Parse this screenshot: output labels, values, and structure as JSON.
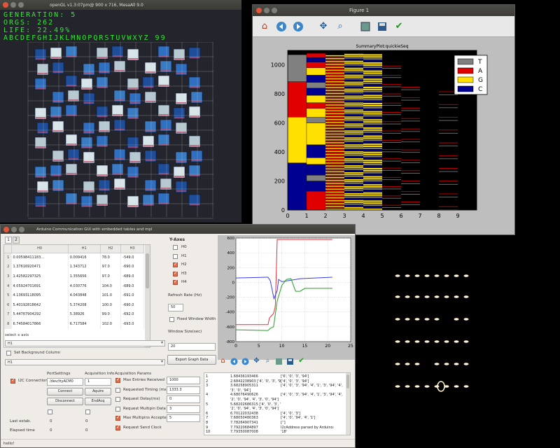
{
  "opengl": {
    "title": "openGL v1.3:07pm@ 900 x 716, MesaAll 9.0",
    "hud": [
      "GENERATION: 5",
      "ORGS: 262",
      "LIFE:   22.49%",
      "ABCDEFGHIJKLMNOPQRSTUVWXYZ 99"
    ]
  },
  "figure": {
    "title": "Figure 1",
    "toolbar": [
      "home-icon",
      "back-icon",
      "forward-icon",
      "pan-icon",
      "zoom-icon",
      "configure-icon",
      "save-icon",
      "check-icon"
    ]
  },
  "chart_data": [
    {
      "type": "bar",
      "title": "SummaryPlot:quickieSeq",
      "x": [
        0,
        1,
        2,
        3,
        4,
        5,
        6,
        7,
        8,
        9
      ],
      "xlim": [
        0,
        10
      ],
      "ylim": [
        0,
        1100
      ],
      "yticks": [
        0,
        200,
        400,
        600,
        800,
        1000
      ],
      "legend": {
        "position": "top-right",
        "entries": [
          {
            "label": "T",
            "color": "#808080"
          },
          {
            "label": "A",
            "color": "#e00000"
          },
          {
            "label": "G",
            "color": "#ffe000"
          },
          {
            "label": "C",
            "color": "#000090"
          }
        ]
      },
      "columns": [
        {
          "x": 0,
          "segments": [
            {
              "base": "C",
              "from": 0,
              "to": 325
            },
            {
              "base": "G",
              "from": 325,
              "to": 640
            },
            {
              "base": "A",
              "from": 640,
              "to": 885
            },
            {
              "base": "T",
              "from": 885,
              "to": 1070
            }
          ]
        },
        {
          "x": 1,
          "segments": [
            {
              "base": "A",
              "from": 0,
              "to": 130
            },
            {
              "base": "C",
              "from": 130,
              "to": 200
            },
            {
              "base": "T",
              "from": 200,
              "to": 240
            },
            {
              "base": "C",
              "from": 240,
              "to": 315
            },
            {
              "base": "G",
              "from": 315,
              "to": 360
            },
            {
              "base": "C",
              "from": 360,
              "to": 450
            },
            {
              "base": "G",
              "from": 450,
              "to": 600
            },
            {
              "base": "T",
              "from": 600,
              "to": 640
            },
            {
              "base": "G",
              "from": 640,
              "to": 700
            },
            {
              "base": "A",
              "from": 700,
              "to": 740
            },
            {
              "base": "G",
              "from": 740,
              "to": 790
            },
            {
              "base": "C",
              "from": 790,
              "to": 840
            },
            {
              "base": "T",
              "from": 840,
              "to": 880
            },
            {
              "base": "C",
              "from": 880,
              "to": 930
            },
            {
              "base": "G",
              "from": 930,
              "to": 980
            },
            {
              "base": "A",
              "from": 980,
              "to": 1020
            },
            {
              "base": "C",
              "from": 1020,
              "to": 1050
            },
            {
              "base": "A",
              "from": 1050,
              "to": 1080
            }
          ]
        }
      ],
      "max_length": 1070,
      "note_columns": "columns 2-8 show progressively thinner striped base composition with similar palette"
    },
    {
      "type": "line",
      "xlim": [
        0,
        25
      ],
      "ylim": [
        -800,
        600
      ],
      "xticks": [
        0,
        5,
        10,
        15,
        20,
        25
      ],
      "yticks": [
        -800,
        -600,
        -400,
        -200,
        0,
        200,
        400,
        600
      ],
      "series": [
        {
          "name": "H3",
          "color": "#e0303a",
          "points": [
            [
              0,
              -570
            ],
            [
              7,
              -570
            ],
            [
              7.3,
              -480
            ],
            [
              7.6,
              -460
            ],
            [
              8.2,
              -420
            ],
            [
              8.5,
              -350
            ],
            [
              8.6,
              -300
            ],
            [
              9,
              580
            ],
            [
              21,
              580
            ]
          ]
        },
        {
          "name": "H4",
          "color": "#3a3aef",
          "points": [
            [
              0,
              60
            ],
            [
              7,
              70
            ],
            [
              7.5,
              20
            ],
            [
              8.3,
              -220
            ],
            [
              9,
              -110
            ],
            [
              9.3,
              40
            ],
            [
              10,
              10
            ],
            [
              13,
              40
            ],
            [
              14,
              50
            ],
            [
              21,
              70
            ]
          ]
        },
        {
          "name": "H2",
          "color": "#22a022",
          "points": [
            [
              0,
              -640
            ],
            [
              7,
              -650
            ],
            [
              7.5,
              -620
            ],
            [
              8.2,
              -600
            ],
            [
              9,
              -250
            ],
            [
              10,
              -40
            ],
            [
              11,
              40
            ],
            [
              12,
              50
            ],
            [
              13,
              -120
            ],
            [
              14,
              -120
            ],
            [
              15,
              -80
            ],
            [
              21,
              -80
            ]
          ]
        }
      ]
    }
  ],
  "arduino": {
    "title": "Arduino Communication GUI with embedded tables and mpl",
    "tabs": [
      "1",
      "2"
    ],
    "table": {
      "headers": [
        "H0",
        "H1",
        "H2",
        "H3"
      ],
      "rows": [
        [
          "1",
          "0.00598411183...",
          "0.009416",
          "78.0",
          "-549.0"
        ],
        [
          "2",
          "1.37616920471",
          "1.343712",
          "97.0",
          "-690.0"
        ],
        [
          "3",
          "1.42582297325",
          "1.355656",
          "97.0",
          "-689.0"
        ],
        [
          "4",
          "4.05924701691",
          "4.030776",
          "104.0",
          "-689.0"
        ],
        [
          "5",
          "4.13693118095",
          "4.043848",
          "101.0",
          "-691.0"
        ],
        [
          "6",
          "5.40192818642",
          "5.374208",
          "100.0",
          "-690.0"
        ],
        [
          "7",
          "5.44767904292",
          "5.38926",
          "99.0",
          "-692.0"
        ],
        [
          "8",
          "6.74584017866",
          "6.717584",
          "102.0",
          "-693.0"
        ]
      ]
    },
    "y_axes_label": "Y-Axes",
    "y_axes": [
      {
        "label": "H0",
        "checked": false
      },
      {
        "label": "H1",
        "checked": false
      },
      {
        "label": "H2",
        "checked": true
      },
      {
        "label": "H3",
        "checked": true
      },
      {
        "label": "H4",
        "checked": true
      }
    ],
    "refresh_label": "Refresh Rate (Hz)",
    "refresh_value": "50",
    "fixed_window_label": "Fixed Window Width",
    "window_size_label": "Window Size(sec)",
    "window_size_value": "20",
    "select_x_label": "select x axis",
    "x_axis_value": "H1",
    "set_bg_label": "Set Background Column",
    "bg_value": "H1",
    "export_label": "Export Graph Data",
    "i2c_label": "I2C Connection",
    "port_settings_label": "PortSettings",
    "port_value": "/dev/ttyACM0",
    "connect_label": "Connect",
    "disconnect_label": "Disconnect",
    "acq_info_label": "Acquisition Info",
    "acq_info_value": "1",
    "aquire_label": "Aquire",
    "endacq_label": "EndAcq",
    "acq_params_label": "Acquisition Params",
    "params": [
      {
        "label": "Max Entries Received",
        "checked": true,
        "value": "1000"
      },
      {
        "label": "Requested Timing (ms)",
        "checked": false,
        "value": "1333.3"
      },
      {
        "label": "Request Delay(ms)",
        "checked": false,
        "value": "0"
      },
      {
        "label": "Request Multipin Data",
        "checked": false,
        "value": "3"
      },
      {
        "label": "Max Multipins Accepted",
        "checked": true,
        "value": "5"
      },
      {
        "label": "Request Send Clock",
        "checked": true,
        "value": ""
      }
    ],
    "last_estab_label": "Last estab.",
    "last_estab_values": [
      "0",
      "0"
    ],
    "elapsed_label": "Elapsed time",
    "elapsed_values": [
      "0",
      "0"
    ],
    "console_rows": [
      {
        "n": "1",
        "v": "1.68436193466",
        "r": "['6', '0', '3', '94']"
      },
      {
        "n": "2",
        "v": "2.6842238903 ['4', '0', '3', '94']",
        "r": "['4', '0', '3', '94']"
      },
      {
        "n": "3",
        "v": "3.68258905311",
        "r": "['4', '0', '3', '94', '4', '1', '3', '94', '4',"
      },
      {
        "n": "",
        "v": "'3', '0', '94']",
        "r": ""
      },
      {
        "n": "4",
        "v": "4.68076490626",
        "r": "['4', '0', '3', '94', '4', '1', '3', '94', '4',"
      },
      {
        "n": "",
        "v": "'2', '0', '94', '4', '3', '0', '94']",
        "r": ""
      },
      {
        "n": "5",
        "v": "5.68202686315 ['4', '0', '3', '94', '4', '1', '3', '94', '4',",
        "r": ""
      },
      {
        "n": "",
        "v": "'2', '0', '94', '4', '3', '0', '94']",
        "r": ""
      },
      {
        "n": "6",
        "v": "6.70122032438",
        "r": "['4', '0', '3']"
      },
      {
        "n": "7",
        "v": "7.68050480363",
        "r": "['4', '0', '94', '4', '1']"
      },
      {
        "n": "8",
        "v": "7.78264907341",
        "r": "['']"
      },
      {
        "n": "9",
        "v": "7.79220684897",
        "r": "I2cAddress parsed by Arduino:"
      },
      {
        "n": "10",
        "v": "7.79350087008",
        "r": "'18'"
      }
    ],
    "status": "hello!"
  }
}
